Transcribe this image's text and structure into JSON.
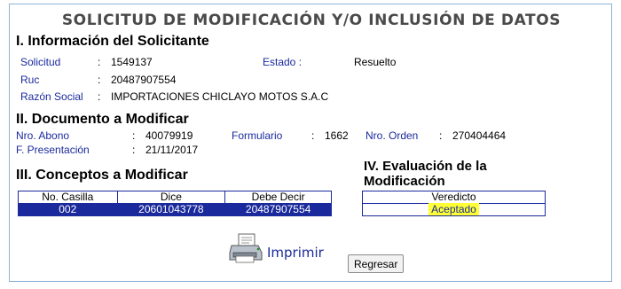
{
  "title": "SOLICITUD DE MODIFICACIÓN Y/O INCLUSIÓN DE DATOS",
  "section1": {
    "heading": "I. Información del Solicitante",
    "solicitud_label": "Solicitud",
    "solicitud_value": "1549137",
    "estado_label": "Estado :",
    "estado_value": "Resuelto",
    "ruc_label": "Ruc",
    "ruc_value": "20487907554",
    "razon_label": "Razón Social",
    "razon_value": "IMPORTACIONES CHICLAYO MOTOS S.A.C"
  },
  "section2": {
    "heading": "II. Documento a Modificar",
    "abono_label": "Nro. Abono",
    "abono_value": "40079919",
    "formulario_label": "Formulario",
    "formulario_value": "1662",
    "orden_label": "Nro. Orden",
    "orden_value": "270404464",
    "presentacion_label": "F. Presentación",
    "presentacion_value": "21/11/2017"
  },
  "section3": {
    "heading": "III. Conceptos a Modificar",
    "columns": [
      "No. Casilla",
      "Dice",
      "Debe Decir"
    ],
    "rows": [
      [
        "002",
        "20601043778",
        "20487907554"
      ]
    ]
  },
  "section4": {
    "heading_line1": "IV. Evaluación de la",
    "heading_line2": "Modificación",
    "column": "Veredicto",
    "value": "Aceptado"
  },
  "actions": {
    "print_label": "Imprimir",
    "back_label": "Regresar"
  },
  "colors": {
    "label_blue": "#1a2a9c",
    "border": "#8fb3d6",
    "highlight": "#ffff33"
  }
}
